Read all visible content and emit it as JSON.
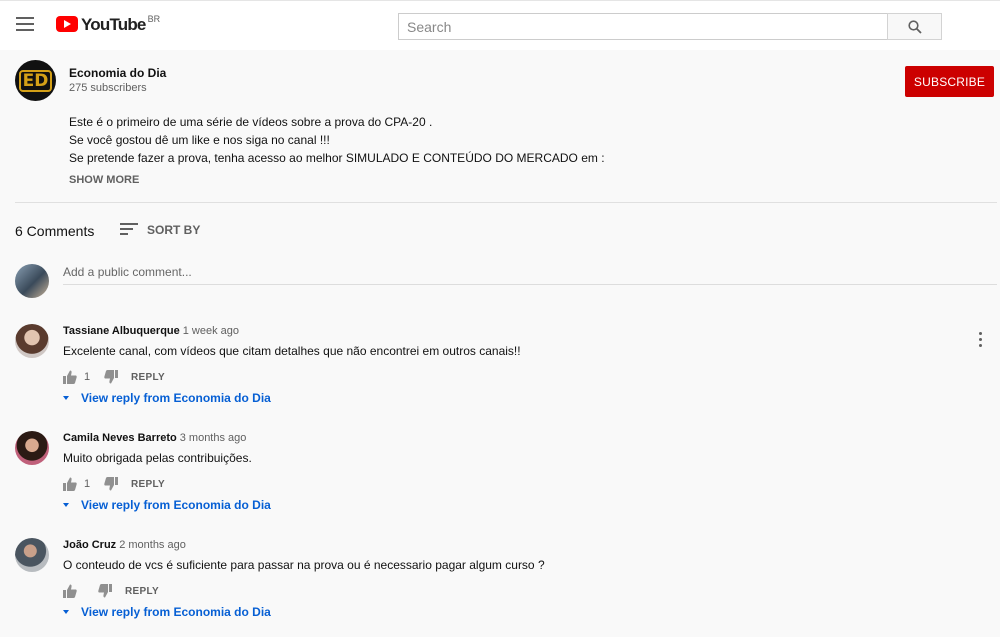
{
  "header": {
    "logo_text": "YouTube",
    "country": "BR",
    "search_placeholder": "Search"
  },
  "channel": {
    "avatar_text": "ED",
    "name": "Economia do Dia",
    "subscribers": "275 subscribers",
    "subscribe_label": "SUBSCRIBE",
    "description": [
      "Este é o primeiro de uma série de vídeos sobre a prova do CPA-20 .",
      "Se você gostou dê um like e nos siga no canal !!!",
      "Se pretende fazer a prova, tenha acesso ao melhor SIMULADO E CONTEÚDO DO MERCADO em :"
    ],
    "show_more": "SHOW MORE"
  },
  "comments": {
    "count_label": "6 Comments",
    "sort_label": "SORT BY",
    "add_placeholder": "Add a public comment...",
    "items": [
      {
        "author": "Tassiane Albuquerque",
        "time": "1 week ago",
        "text": "Excelente canal, com vídeos que citam detalhes que não encontrei em outros canais!!",
        "likes": "1",
        "reply_label": "REPLY",
        "view_reply": "View reply from Economia do Dia"
      },
      {
        "author": "Camila Neves Barreto",
        "time": "3 months ago",
        "text": "Muito obrigada pelas contribuições.",
        "likes": "1",
        "reply_label": "REPLY",
        "view_reply": "View reply from Economia do Dia"
      },
      {
        "author": "João Cruz",
        "time": "2 months ago",
        "text": "O conteudo de vcs é suficiente para passar na prova ou é necessario pagar algum curso ?",
        "likes": "",
        "reply_label": "REPLY",
        "view_reply": "View reply from Economia do Dia"
      }
    ]
  },
  "colors": {
    "brand_red": "#ff0000",
    "subscribe_red": "#cc0000",
    "link_blue": "#065fd4"
  }
}
